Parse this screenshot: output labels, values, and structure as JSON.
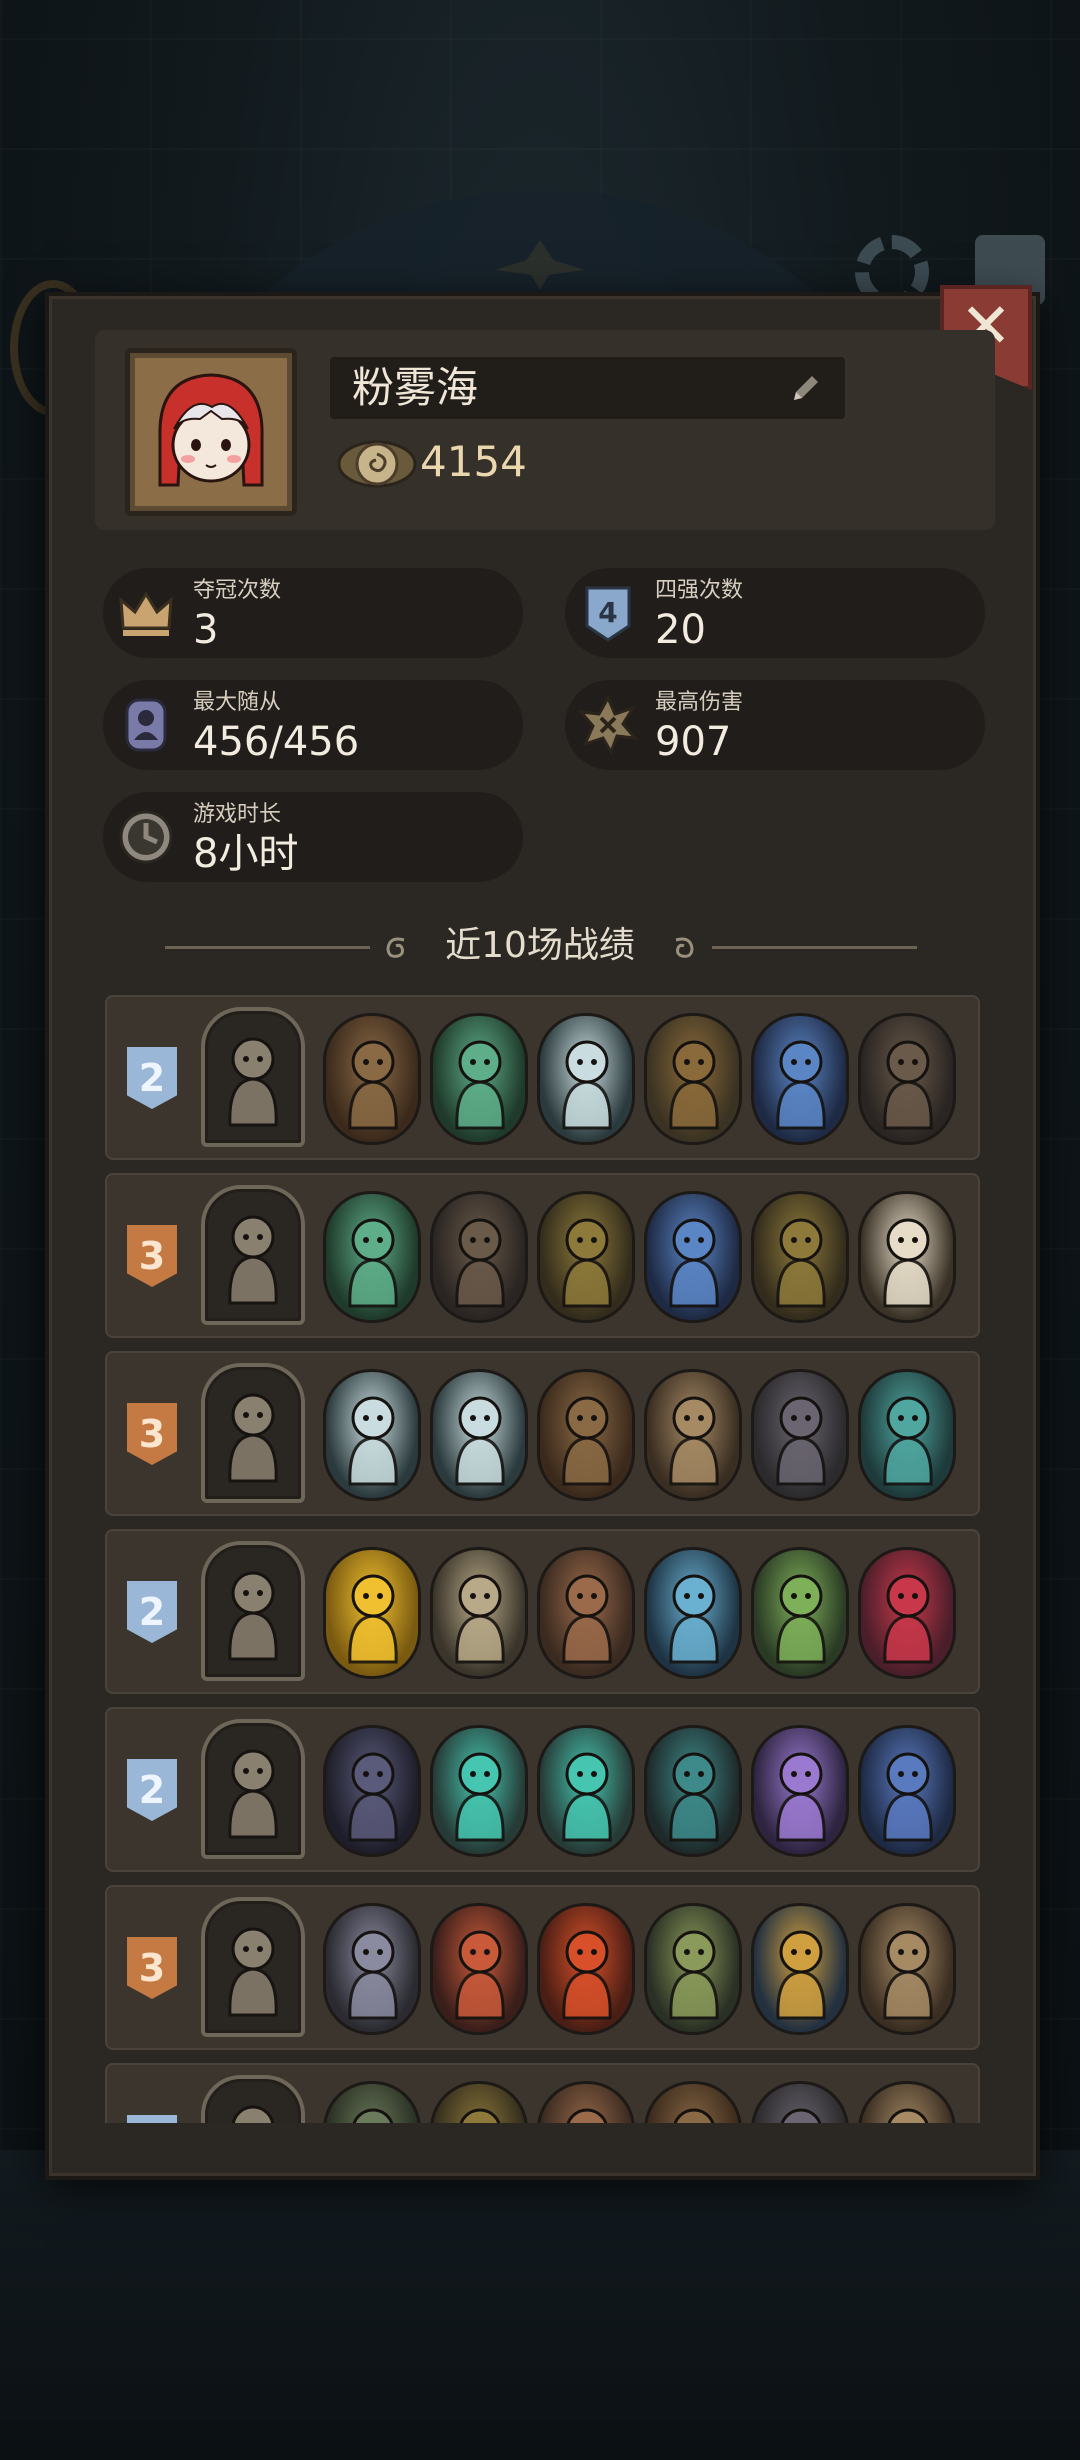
{
  "profile": {
    "name": "粉雾海",
    "coins": "4154"
  },
  "stats": {
    "championships": {
      "label": "夺冠次数",
      "value": "3"
    },
    "top4": {
      "label": "四强次数",
      "value": "20"
    },
    "max_followers": {
      "label": "最大随从",
      "value": "456/456"
    },
    "max_damage": {
      "label": "最高伤害",
      "value": "907"
    },
    "playtime": {
      "label": "游戏时长",
      "value": "8小时"
    }
  },
  "section_title": "近10场战绩",
  "colors": {
    "panel": "#2b2723",
    "row": "#3b352e",
    "rank_silver": "#9ab7d8",
    "rank_bronze": "#c57a43",
    "close_button": "#8a3b34"
  },
  "matches": [
    {
      "rank": "2",
      "rank_style": "silver",
      "hero": "horned-warrior-hero",
      "units": [
        {
          "name": "tree-golem",
          "c1": "#3b2a1c",
          "c2": "#8a6a45"
        },
        {
          "name": "vine-plant",
          "c1": "#1f3a2a",
          "c2": "#5fae8a"
        },
        {
          "name": "robot",
          "c1": "#2b3a3c",
          "c2": "#c9dde0"
        },
        {
          "name": "scarecrow-witch",
          "c1": "#3a3222",
          "c2": "#8a6a3a"
        },
        {
          "name": "blue-elf",
          "c1": "#1e2a44",
          "c2": "#5b86c6"
        },
        {
          "name": "hooded-rogue",
          "c1": "#2a2522",
          "c2": "#6a5a4a"
        }
      ]
    },
    {
      "rank": "3",
      "rank_style": "bronze",
      "hero": "blue-beast-hero",
      "units": [
        {
          "name": "vine-plant",
          "c1": "#1f3a2a",
          "c2": "#5fae8a"
        },
        {
          "name": "hooded-rogue",
          "c1": "#2a2522",
          "c2": "#6a5a4a"
        },
        {
          "name": "witch",
          "c1": "#332c1c",
          "c2": "#8d7a3a"
        },
        {
          "name": "blue-elf",
          "c1": "#1e2a44",
          "c2": "#5b86c6"
        },
        {
          "name": "witch",
          "c1": "#332c1c",
          "c2": "#8d7a3a"
        },
        {
          "name": "eagle",
          "c1": "#3a3226",
          "c2": "#e6dcc8"
        }
      ]
    },
    {
      "rank": "3",
      "rank_style": "bronze",
      "hero": "wolf-hero",
      "units": [
        {
          "name": "robot",
          "c1": "#2b3a3c",
          "c2": "#c9dde0"
        },
        {
          "name": "robot",
          "c1": "#2b3a3c",
          "c2": "#c9dde0"
        },
        {
          "name": "tree-golem",
          "c1": "#3b2a1c",
          "c2": "#8a6a45"
        },
        {
          "name": "voodoo-doll",
          "c1": "#3a2e22",
          "c2": "#a68a64"
        },
        {
          "name": "goblin",
          "c1": "#2b2a2c",
          "c2": "#6a6570"
        },
        {
          "name": "teal-monster",
          "c1": "#1e3a3a",
          "c2": "#4fa7a0"
        }
      ]
    },
    {
      "rank": "2",
      "rank_style": "silver",
      "hero": "blue-ogre-hero",
      "units": [
        {
          "name": "fire-elemental",
          "c1": "#7a5a10",
          "c2": "#f0c030"
        },
        {
          "name": "skeleton",
          "c1": "#3a342a",
          "c2": "#b8aa88"
        },
        {
          "name": "cowboy",
          "c1": "#3a2a20",
          "c2": "#9a6a4a"
        },
        {
          "name": "blue-rabbit",
          "c1": "#1e3444",
          "c2": "#6ab0d0"
        },
        {
          "name": "green-dragon",
          "c1": "#2a3a24",
          "c2": "#7eb05a"
        },
        {
          "name": "jester",
          "c1": "#4a1e2a",
          "c2": "#c8384a"
        }
      ]
    },
    {
      "rank": "2",
      "rank_style": "silver",
      "hero": "hooded-mage-hero",
      "units": [
        {
          "name": "dark-knight",
          "c1": "#1e1e2a",
          "c2": "#5a5a7a"
        },
        {
          "name": "treasure-chest",
          "c1": "#263a36",
          "c2": "#46c6b0"
        },
        {
          "name": "treasure-chest",
          "c1": "#263a36",
          "c2": "#46c6b0"
        },
        {
          "name": "boatman",
          "c1": "#1e2a2a",
          "c2": "#3e8a8a"
        },
        {
          "name": "sorceress",
          "c1": "#2e2440",
          "c2": "#9a7ad0"
        },
        {
          "name": "blue-wizard",
          "c1": "#1e2a44",
          "c2": "#5a7ac0"
        }
      ]
    },
    {
      "rank": "3",
      "rank_style": "bronze",
      "hero": "blonde-knight-hero",
      "units": [
        {
          "name": "grey-dragon",
          "c1": "#2a2a30",
          "c2": "#8a8aa0"
        },
        {
          "name": "scorpion",
          "c1": "#3a1e1a",
          "c2": "#c85a3a"
        },
        {
          "name": "red-demon",
          "c1": "#4a1e14",
          "c2": "#d8502a"
        },
        {
          "name": "bard",
          "c1": "#2a3024",
          "c2": "#8a9a5a"
        },
        {
          "name": "crab-soldier",
          "c1": "#223040",
          "c2": "#d0a040"
        },
        {
          "name": "voodoo-doll",
          "c1": "#3a2e22",
          "c2": "#a68a64"
        }
      ]
    },
    {
      "rank": "",
      "rank_style": "silver",
      "hero": "dark-hero",
      "units": [
        {
          "name": "scarecrow",
          "c1": "#2a3024",
          "c2": "#6a7a5a"
        },
        {
          "name": "witch",
          "c1": "#332c1c",
          "c2": "#8d7a3a"
        },
        {
          "name": "cowboy",
          "c1": "#3a2a20",
          "c2": "#9a6a4a"
        },
        {
          "name": "tree-golem",
          "c1": "#3b2a1c",
          "c2": "#8a6a45"
        },
        {
          "name": "goblin",
          "c1": "#2b2a2c",
          "c2": "#6a6570"
        },
        {
          "name": "voodoo-doll",
          "c1": "#3a2e22",
          "c2": "#a68a64"
        }
      ]
    }
  ]
}
